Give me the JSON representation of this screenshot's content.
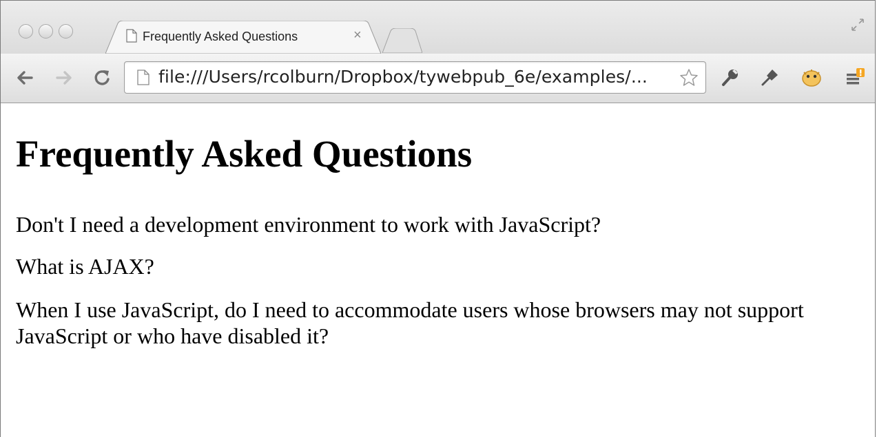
{
  "tab": {
    "title": "Frequently Asked Questions",
    "close": "×"
  },
  "toolbar": {
    "url": "file:///Users/rcolburn/Dropbox/tywebpub_6e/examples/..."
  },
  "icons": {
    "back": "back-arrow-icon",
    "forward": "forward-arrow-icon",
    "reload": "reload-icon",
    "page": "page-icon",
    "star": "star-icon",
    "wrench": "wrench-icon",
    "pin": "pin-icon",
    "extension": "pufferfish-extension-icon",
    "menu": "menu-alert-icon"
  },
  "page": {
    "heading": "Frequently Asked Questions",
    "questions": [
      "Don't I need a development environment to work with JavaScript?",
      "What is AJAX?",
      "When I use JavaScript, do I need to accommodate users whose browsers may not support JavaScript or who have disabled it?"
    ]
  }
}
